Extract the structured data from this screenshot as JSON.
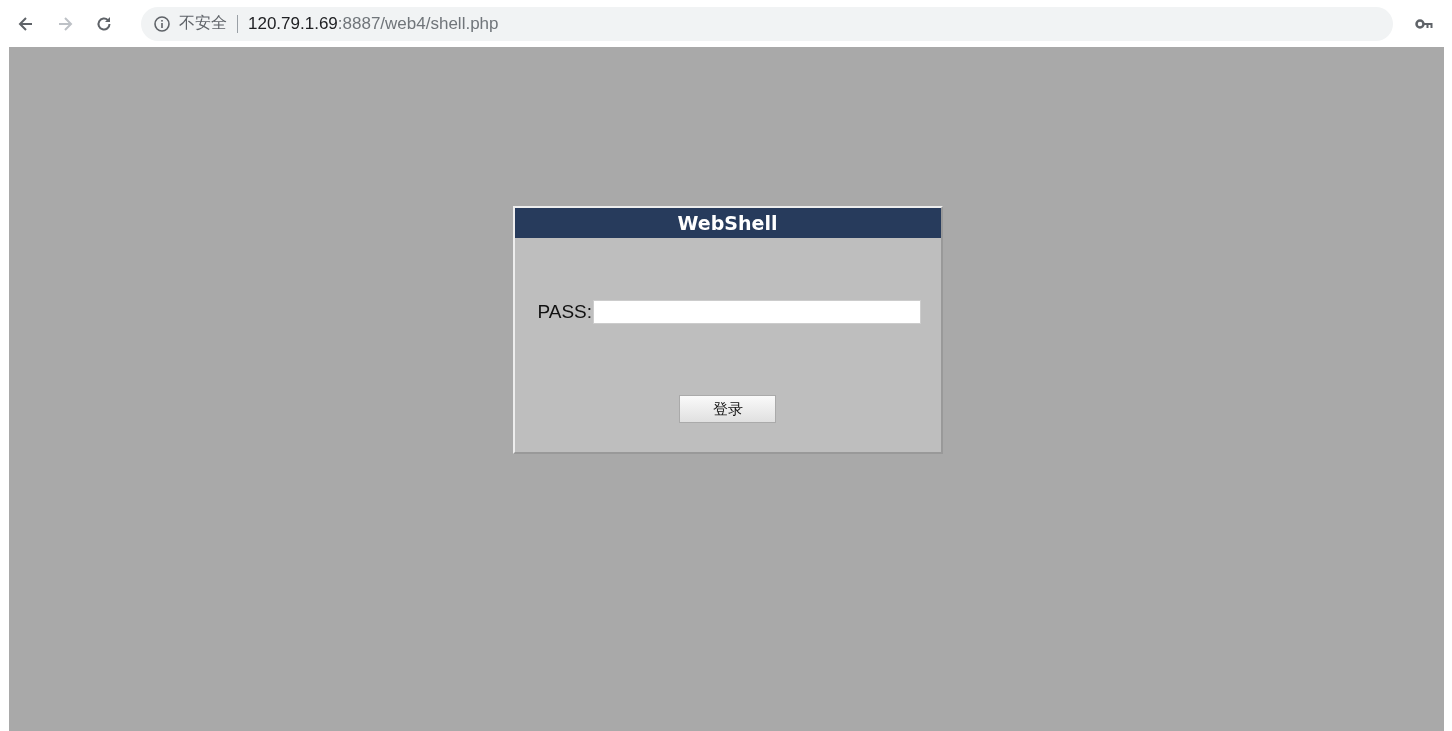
{
  "browser": {
    "back": {
      "disabled": false
    },
    "forward": {
      "disabled": true
    },
    "security_label": "不安全",
    "url_host": "120.79.1.69",
    "url_rest": ":8887/web4/shell.php"
  },
  "login": {
    "title": "WebShell",
    "password_label": "PASS:",
    "submit": "登录"
  }
}
